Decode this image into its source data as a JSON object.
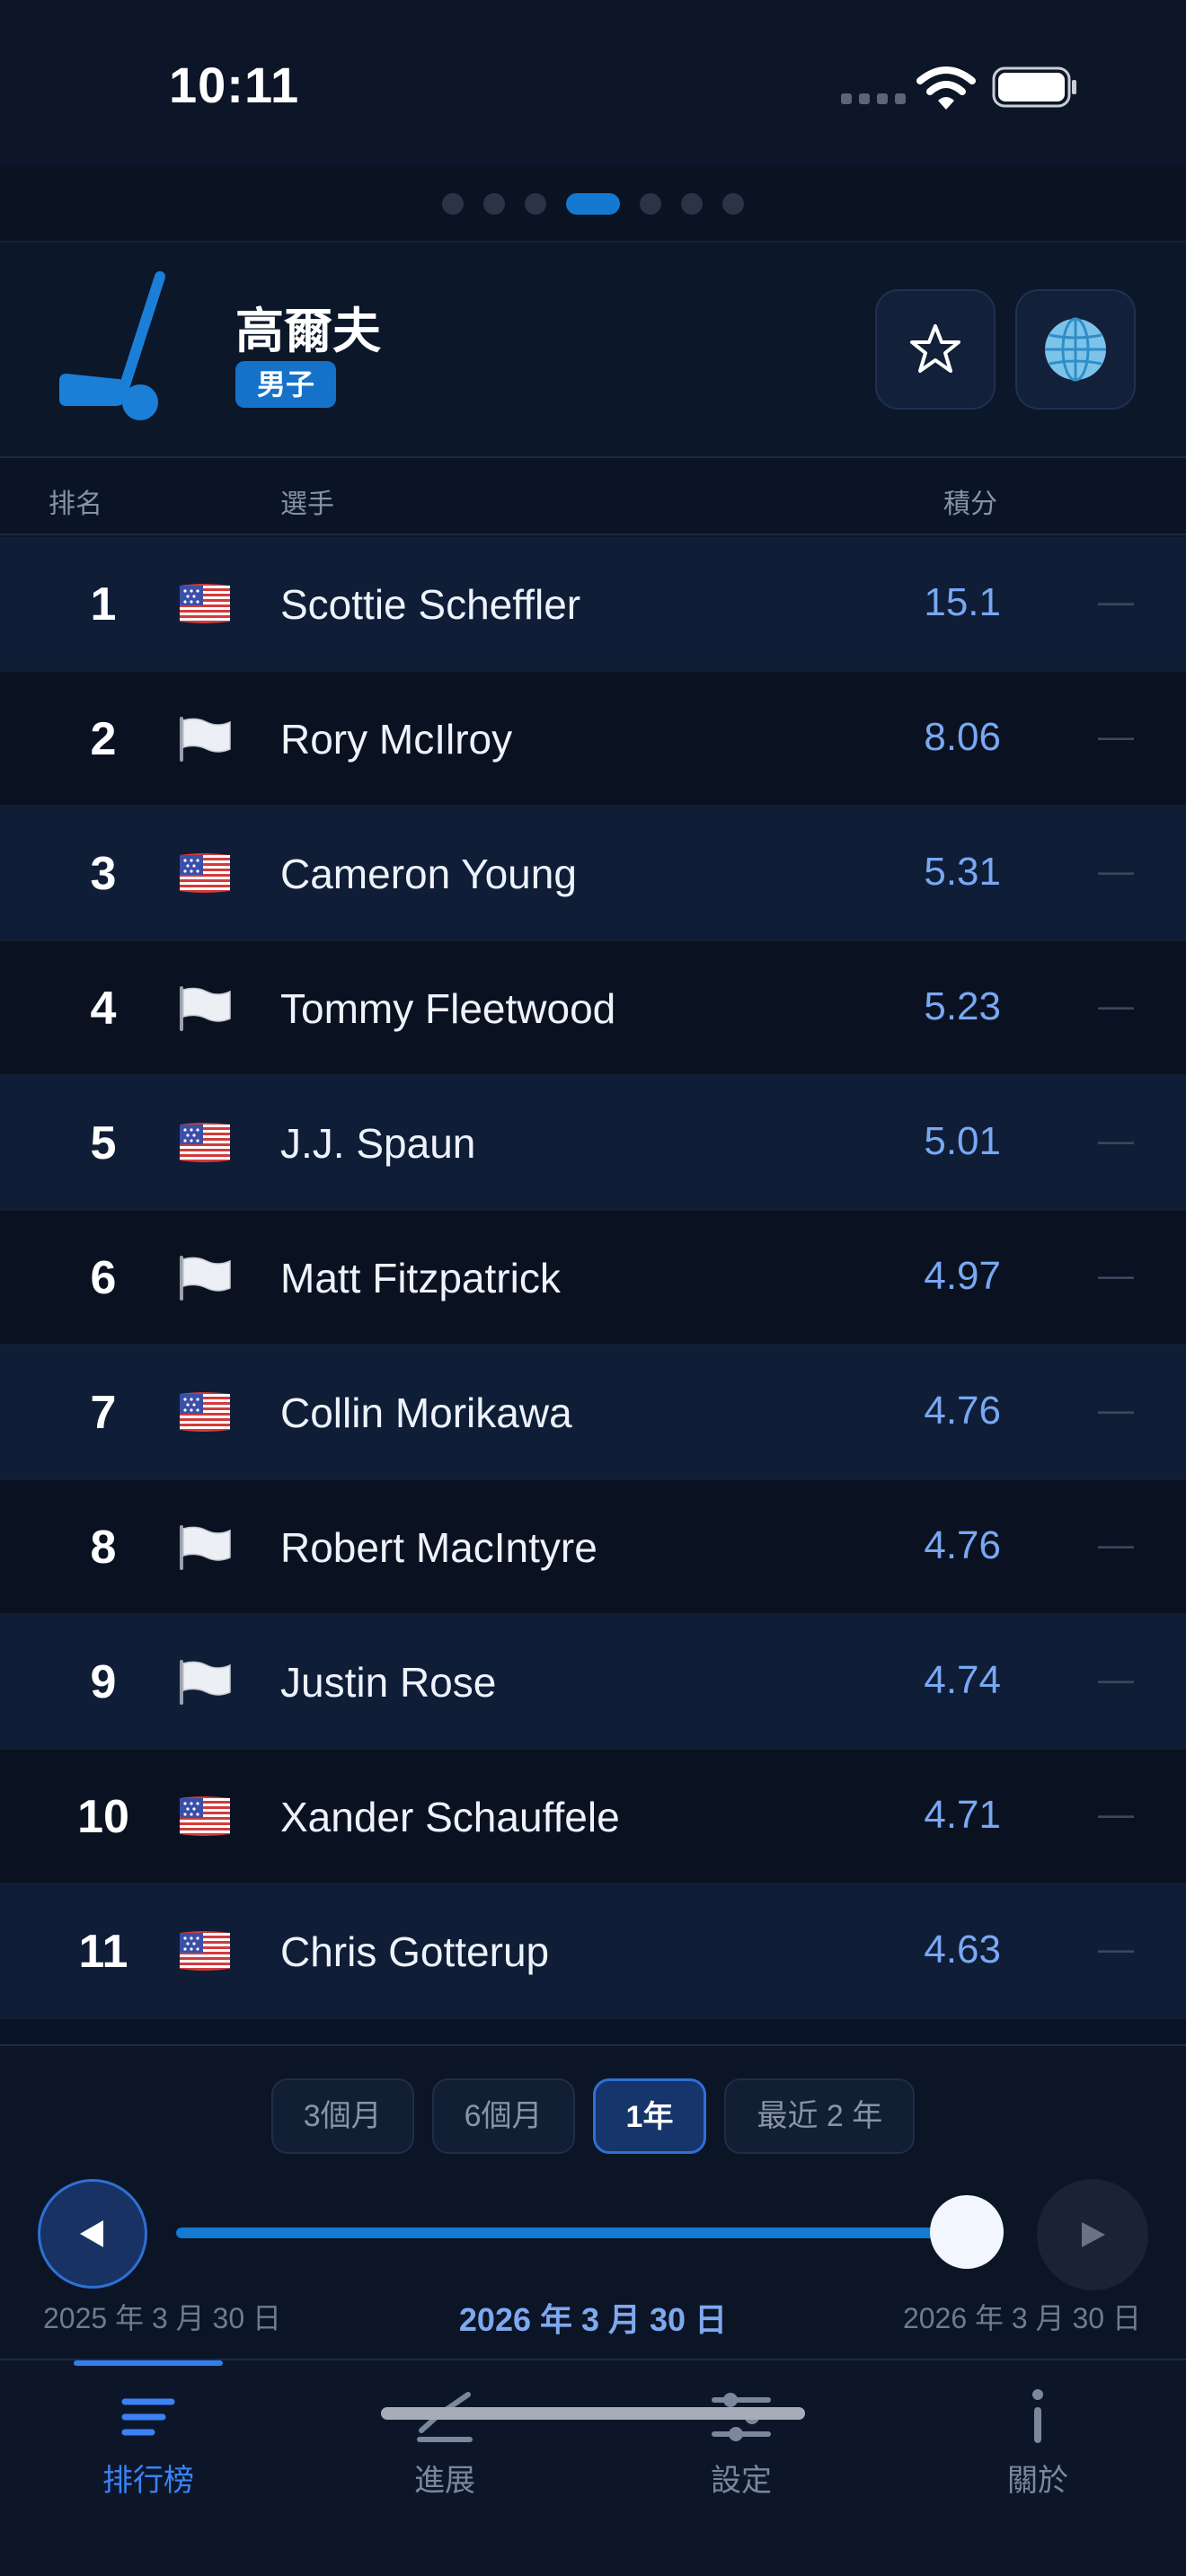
{
  "status_bar": {
    "time": "10:11"
  },
  "page_indicator": {
    "count": 7,
    "active_index": 3
  },
  "header": {
    "sport_title": "高爾夫",
    "category_badge": "男子",
    "sport_icon": "golf-club-icon",
    "favorite_icon": "star-icon",
    "region_icon": "globe-icon"
  },
  "table": {
    "columns": {
      "rank": "排名",
      "player": "選手",
      "points": "積分"
    },
    "rows": [
      {
        "rank": "1",
        "flag": "us",
        "player": "Scottie Scheffler",
        "points": "15.1",
        "trend": "—"
      },
      {
        "rank": "2",
        "flag": "white",
        "player": "Rory McIlroy",
        "points": "8.06",
        "trend": "—"
      },
      {
        "rank": "3",
        "flag": "us",
        "player": "Cameron Young",
        "points": "5.31",
        "trend": "—"
      },
      {
        "rank": "4",
        "flag": "white",
        "player": "Tommy Fleetwood",
        "points": "5.23",
        "trend": "—"
      },
      {
        "rank": "5",
        "flag": "us",
        "player": "J.J. Spaun",
        "points": "5.01",
        "trend": "—"
      },
      {
        "rank": "6",
        "flag": "white",
        "player": "Matt Fitzpatrick",
        "points": "4.97",
        "trend": "—"
      },
      {
        "rank": "7",
        "flag": "us",
        "player": "Collin Morikawa",
        "points": "4.76",
        "trend": "—"
      },
      {
        "rank": "8",
        "flag": "white",
        "player": "Robert MacIntyre",
        "points": "4.76",
        "trend": "—"
      },
      {
        "rank": "9",
        "flag": "white",
        "player": "Justin Rose",
        "points": "4.74",
        "trend": "—"
      },
      {
        "rank": "10",
        "flag": "us",
        "player": "Xander Schauffele",
        "points": "4.71",
        "trend": "—"
      },
      {
        "rank": "11",
        "flag": "us",
        "player": "Chris Gotterup",
        "points": "4.63",
        "trend": "—"
      }
    ]
  },
  "range_controls": {
    "options": [
      "3個月",
      "6個月",
      "1年",
      "最近 2 年"
    ],
    "selected": "1年",
    "date_start": "2025 年 3 月 30 日",
    "date_current": "2026 年 3 月 30 日",
    "date_end": "2026 年 3 月 30 日",
    "slider_position": 1.0
  },
  "tabs": [
    {
      "label": "排行榜",
      "icon": "list-icon",
      "active": true
    },
    {
      "label": "進展",
      "icon": "chart-line-icon",
      "active": false
    },
    {
      "label": "設定",
      "icon": "sliders-icon",
      "active": false
    },
    {
      "label": "關於",
      "icon": "info-icon",
      "active": false
    }
  ],
  "colors": {
    "accent": "#1479d0",
    "points": "#79a8f3",
    "active_tab": "#3b82f6",
    "background": "#0b1426"
  }
}
